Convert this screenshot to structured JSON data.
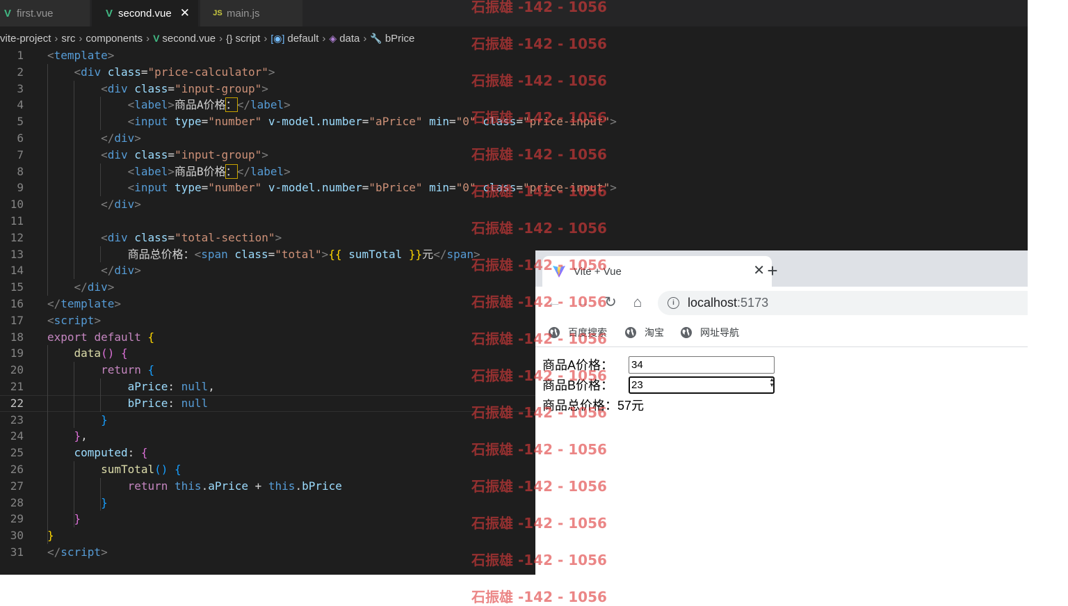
{
  "editor": {
    "tabs": [
      {
        "icon": "vue",
        "label": "first.vue",
        "active": false
      },
      {
        "icon": "vue",
        "label": "second.vue",
        "active": true
      },
      {
        "icon": "js",
        "label": "main.js",
        "active": false
      }
    ],
    "close_glyph": "✕",
    "icon_glyphs": {
      "vue": "V",
      "js": "JS"
    },
    "breadcrumb": [
      {
        "icon": "",
        "label": "vite-project"
      },
      {
        "icon": "",
        "label": "src"
      },
      {
        "icon": "",
        "label": "components"
      },
      {
        "icon": "vue-icon",
        "label": "second.vue"
      },
      {
        "icon": "braces-icon",
        "label": "script"
      },
      {
        "icon": "module-icon",
        "label": "default"
      },
      {
        "icon": "cube-icon",
        "label": "data"
      },
      {
        "icon": "wrench-icon",
        "label": "bPrice"
      }
    ],
    "breadcrumb_separator": "›",
    "current_line": 22,
    "lines": [
      [
        [
          "t-tag",
          "<"
        ],
        [
          "t-name",
          "template"
        ],
        [
          "t-tag",
          ">"
        ]
      ],
      [
        [
          "t-txt",
          "    "
        ],
        [
          "t-tag",
          "<"
        ],
        [
          "t-name",
          "div"
        ],
        [
          "t-txt",
          " "
        ],
        [
          "t-attr",
          "class"
        ],
        [
          "t-txt",
          "="
        ],
        [
          "t-str",
          "\"price-calculator\""
        ],
        [
          "t-tag",
          ">"
        ]
      ],
      [
        [
          "t-txt",
          "        "
        ],
        [
          "t-tag",
          "<"
        ],
        [
          "t-name",
          "div"
        ],
        [
          "t-txt",
          " "
        ],
        [
          "t-attr",
          "class"
        ],
        [
          "t-txt",
          "="
        ],
        [
          "t-str",
          "\"input-group\""
        ],
        [
          "t-tag",
          ">"
        ]
      ],
      [
        [
          "t-txt",
          "            "
        ],
        [
          "t-tag",
          "<"
        ],
        [
          "t-name",
          "label"
        ],
        [
          "t-tag",
          ">"
        ],
        [
          "t-txt",
          "商品A价格"
        ],
        [
          "hlbox t-txt",
          "："
        ],
        [
          "t-tag",
          "</"
        ],
        [
          "t-name",
          "label"
        ],
        [
          "t-tag",
          ">"
        ]
      ],
      [
        [
          "t-txt",
          "            "
        ],
        [
          "t-tag",
          "<"
        ],
        [
          "t-name",
          "input"
        ],
        [
          "t-txt",
          " "
        ],
        [
          "t-attr",
          "type"
        ],
        [
          "t-txt",
          "="
        ],
        [
          "t-str",
          "\"number\""
        ],
        [
          "t-txt",
          " "
        ],
        [
          "t-attr",
          "v-model.number"
        ],
        [
          "t-txt",
          "="
        ],
        [
          "t-str",
          "\"aPrice\""
        ],
        [
          "t-txt",
          " "
        ],
        [
          "t-attr",
          "min"
        ],
        [
          "t-txt",
          "="
        ],
        [
          "t-str",
          "\"0\""
        ],
        [
          "t-txt",
          " "
        ],
        [
          "t-attr",
          "class"
        ],
        [
          "t-txt",
          "="
        ],
        [
          "t-str",
          "\"price-input\""
        ],
        [
          "t-tag",
          ">"
        ]
      ],
      [
        [
          "t-txt",
          "        "
        ],
        [
          "t-tag",
          "</"
        ],
        [
          "t-name",
          "div"
        ],
        [
          "t-tag",
          ">"
        ]
      ],
      [
        [
          "t-txt",
          "        "
        ],
        [
          "t-tag",
          "<"
        ],
        [
          "t-name",
          "div"
        ],
        [
          "t-txt",
          " "
        ],
        [
          "t-attr",
          "class"
        ],
        [
          "t-txt",
          "="
        ],
        [
          "t-str",
          "\"input-group\""
        ],
        [
          "t-tag",
          ">"
        ]
      ],
      [
        [
          "t-txt",
          "            "
        ],
        [
          "t-tag",
          "<"
        ],
        [
          "t-name",
          "label"
        ],
        [
          "t-tag",
          ">"
        ],
        [
          "t-txt",
          "商品B价格"
        ],
        [
          "hlbox t-txt",
          "："
        ],
        [
          "t-tag",
          "</"
        ],
        [
          "t-name",
          "label"
        ],
        [
          "t-tag",
          ">"
        ]
      ],
      [
        [
          "t-txt",
          "            "
        ],
        [
          "t-tag",
          "<"
        ],
        [
          "t-name",
          "input"
        ],
        [
          "t-txt",
          " "
        ],
        [
          "t-attr",
          "type"
        ],
        [
          "t-txt",
          "="
        ],
        [
          "t-str",
          "\"number\""
        ],
        [
          "t-txt",
          " "
        ],
        [
          "t-attr",
          "v-model.number"
        ],
        [
          "t-txt",
          "="
        ],
        [
          "t-str",
          "\"bPrice\""
        ],
        [
          "t-txt",
          " "
        ],
        [
          "t-attr",
          "min"
        ],
        [
          "t-txt",
          "="
        ],
        [
          "t-str",
          "\"0\""
        ],
        [
          "t-txt",
          " "
        ],
        [
          "t-attr",
          "class"
        ],
        [
          "t-txt",
          "="
        ],
        [
          "t-str",
          "\"price-input\""
        ],
        [
          "t-tag",
          ">"
        ]
      ],
      [
        [
          "t-txt",
          "        "
        ],
        [
          "t-tag",
          "</"
        ],
        [
          "t-name",
          "div"
        ],
        [
          "t-tag",
          ">"
        ]
      ],
      [
        [
          "t-txt",
          ""
        ]
      ],
      [
        [
          "t-txt",
          "        "
        ],
        [
          "t-tag",
          "<"
        ],
        [
          "t-name",
          "div"
        ],
        [
          "t-txt",
          " "
        ],
        [
          "t-attr",
          "class"
        ],
        [
          "t-txt",
          "="
        ],
        [
          "t-str",
          "\"total-section\""
        ],
        [
          "t-tag",
          ">"
        ]
      ],
      [
        [
          "t-txt",
          "            商品总价格："
        ],
        [
          "t-tag",
          "<"
        ],
        [
          "t-name",
          "span"
        ],
        [
          "t-txt",
          " "
        ],
        [
          "t-attr",
          "class"
        ],
        [
          "t-txt",
          "="
        ],
        [
          "t-str",
          "\"total\""
        ],
        [
          "t-tag",
          ">"
        ],
        [
          "t-br1",
          "{{"
        ],
        [
          "t-txt",
          " "
        ],
        [
          "t-prop",
          "sumTotal"
        ],
        [
          "t-txt",
          " "
        ],
        [
          "t-br1",
          "}}"
        ],
        [
          "t-txt",
          "元"
        ],
        [
          "t-tag",
          "</"
        ],
        [
          "t-name",
          "span"
        ],
        [
          "t-tag",
          ">"
        ]
      ],
      [
        [
          "t-txt",
          "        "
        ],
        [
          "t-tag",
          "</"
        ],
        [
          "t-name",
          "div"
        ],
        [
          "t-tag",
          ">"
        ]
      ],
      [
        [
          "t-txt",
          "    "
        ],
        [
          "t-tag",
          "</"
        ],
        [
          "t-name",
          "div"
        ],
        [
          "t-tag",
          ">"
        ]
      ],
      [
        [
          "t-tag",
          "</"
        ],
        [
          "t-name",
          "template"
        ],
        [
          "t-tag",
          ">"
        ]
      ],
      [
        [
          "t-tag",
          "<"
        ],
        [
          "t-name",
          "script"
        ],
        [
          "t-tag",
          ">"
        ]
      ],
      [
        [
          "t-kw",
          "export"
        ],
        [
          "t-txt",
          " "
        ],
        [
          "t-kw",
          "default"
        ],
        [
          "t-txt",
          " "
        ],
        [
          "t-br1",
          "{"
        ]
      ],
      [
        [
          "t-txt",
          "    "
        ],
        [
          "t-fn",
          "data"
        ],
        [
          "t-br2",
          "()"
        ],
        [
          "t-txt",
          " "
        ],
        [
          "t-br2",
          "{"
        ]
      ],
      [
        [
          "t-txt",
          "        "
        ],
        [
          "t-kw",
          "return"
        ],
        [
          "t-txt",
          " "
        ],
        [
          "t-br3",
          "{"
        ]
      ],
      [
        [
          "t-txt",
          "            "
        ],
        [
          "t-prop",
          "aPrice"
        ],
        [
          "t-txt",
          ": "
        ],
        [
          "t-kw2",
          "null"
        ],
        [
          "t-txt",
          ","
        ]
      ],
      [
        [
          "t-txt",
          "            "
        ],
        [
          "t-prop",
          "bPrice"
        ],
        [
          "t-txt",
          ": "
        ],
        [
          "t-kw2",
          "null"
        ]
      ],
      [
        [
          "t-txt",
          "        "
        ],
        [
          "t-br3",
          "}"
        ]
      ],
      [
        [
          "t-txt",
          "    "
        ],
        [
          "t-br2",
          "}"
        ],
        [
          "t-txt",
          ","
        ]
      ],
      [
        [
          "t-txt",
          "    "
        ],
        [
          "t-prop",
          "computed"
        ],
        [
          "t-txt",
          ": "
        ],
        [
          "t-br2",
          "{"
        ]
      ],
      [
        [
          "t-txt",
          "        "
        ],
        [
          "t-fn",
          "sumTotal"
        ],
        [
          "t-br3",
          "()"
        ],
        [
          "t-txt",
          " "
        ],
        [
          "t-br3",
          "{"
        ]
      ],
      [
        [
          "t-txt",
          "            "
        ],
        [
          "t-kw",
          "return"
        ],
        [
          "t-txt",
          " "
        ],
        [
          "t-kw2",
          "this"
        ],
        [
          "t-txt",
          "."
        ],
        [
          "t-prop",
          "aPrice"
        ],
        [
          "t-txt",
          " + "
        ],
        [
          "t-kw2",
          "this"
        ],
        [
          "t-txt",
          "."
        ],
        [
          "t-prop",
          "bPrice"
        ]
      ],
      [
        [
          "t-txt",
          "        "
        ],
        [
          "t-br3",
          "}"
        ]
      ],
      [
        [
          "t-txt",
          "    "
        ],
        [
          "t-br2",
          "}"
        ]
      ],
      [
        [
          "t-br1",
          "}"
        ]
      ],
      [
        [
          "t-tag",
          "</"
        ],
        [
          "t-name",
          "script"
        ],
        [
          "t-tag",
          ">"
        ]
      ]
    ]
  },
  "browser": {
    "tab_title": "Vite + Vue",
    "tab_close": "✕",
    "new_tab": "+",
    "nav": {
      "back": "←",
      "forward": "→",
      "reload": "↻",
      "home": "⌂"
    },
    "info_glyph": "i",
    "url_host": "localhost",
    "url_port": ":5173",
    "bookmarks": [
      "百度搜索",
      "淘宝",
      "网址导航"
    ],
    "page": {
      "a_label": "商品A价格：",
      "a_value": "34",
      "b_label": "商品B价格：",
      "b_value": "23",
      "spin_up": "▲",
      "spin_down": "▼",
      "total_label": "商品总价格：",
      "total_value": "57元"
    }
  },
  "watermark": {
    "text": "石振雄 -142 - 1056",
    "count": 17
  }
}
